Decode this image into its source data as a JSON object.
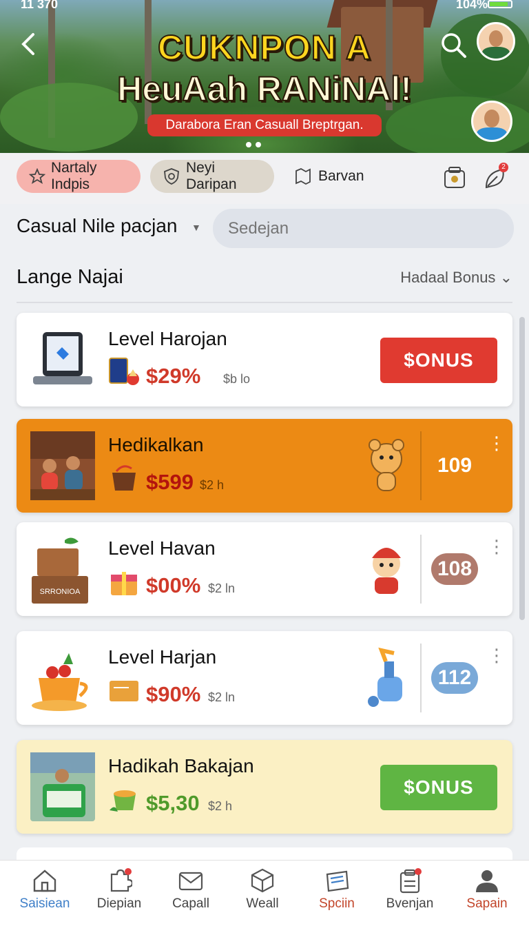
{
  "status_bar": {
    "time": "11 370",
    "battery": "104%"
  },
  "hero": {
    "title_line1": "CUKNPON A",
    "title_line2": "HeuAah RANiNAl!",
    "tagline": "Darabora Eran Casuall Breptrgan."
  },
  "chips": [
    {
      "label": "Nartaly Indpis",
      "icon": "star-icon"
    },
    {
      "label": "Neyi Daripan",
      "icon": "shield-icon"
    },
    {
      "label": "Barvan",
      "icon": "map-icon"
    }
  ],
  "category": {
    "title": "Casual Nile pacjan",
    "search_placeholder": "Sedejan"
  },
  "section": {
    "title": "Lange Najai",
    "sort_label": "Hadaal Bonus"
  },
  "cards": [
    {
      "title": "Level Harojan",
      "price": "$29%",
      "unit": "$b lo",
      "cta": "$ONUS",
      "variant": "white"
    },
    {
      "title": "Hedikalkan",
      "price": "$599",
      "unit": "$2 h",
      "score": "109",
      "variant": "orange"
    },
    {
      "title": "Level Havan",
      "price": "$00%",
      "unit": "$2 ln",
      "score": "108",
      "variant": "white",
      "thumb_label": "SRRONIOA"
    },
    {
      "title": "Level Harjan",
      "price": "$90%",
      "unit": "$2 ln",
      "score": "112",
      "variant": "white"
    },
    {
      "title": "Hadikah Bakajan",
      "price": "$5,30",
      "unit": "$2 h",
      "cta": "$ONUS",
      "variant": "yellow"
    }
  ],
  "colors": {
    "accent_red": "#e03a30",
    "accent_green": "#5fb543",
    "score_brown": "#b07a6c",
    "score_blue": "#7aa9d8",
    "orange_card": "#ec8a14"
  },
  "nav": [
    {
      "label": "Saisiean",
      "icon": "home-icon"
    },
    {
      "label": "Diepian",
      "icon": "puzzle-icon"
    },
    {
      "label": "Capall",
      "icon": "mail-heart-icon"
    },
    {
      "label": "Weall",
      "icon": "cube-icon"
    },
    {
      "label": "Spciin",
      "icon": "ticket-icon"
    },
    {
      "label": "Bvenjan",
      "icon": "clipboard-icon"
    },
    {
      "label": "Sapain",
      "icon": "profile-icon"
    }
  ]
}
